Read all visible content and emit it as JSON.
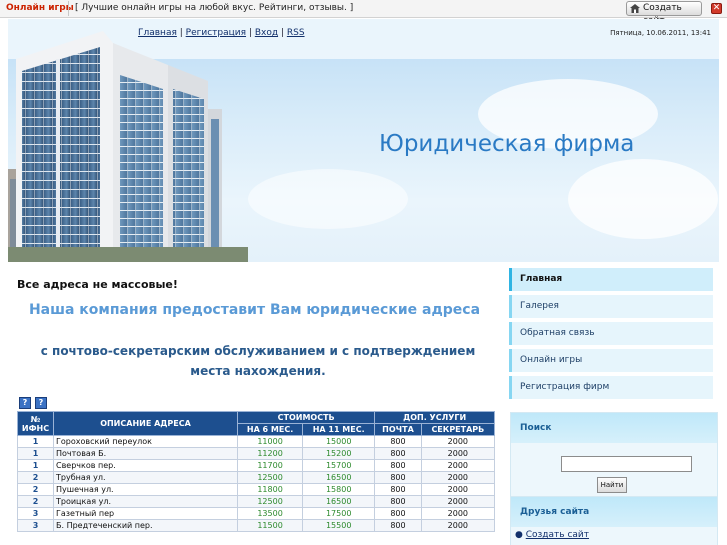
{
  "topbar": {
    "brand": "Онлайн игры",
    "tagline": "[ Лучшие онлайн игры на любой вкус. Рейтинги, отзывы. ]",
    "create_site": "Создать сайт",
    "close": "✕"
  },
  "header": {
    "nav": [
      "Главная",
      "Регистрация",
      "Вход",
      "RSS"
    ],
    "date": "Пятница, 10.06.2011, 13:41",
    "site_title": "Юридическая фирма"
  },
  "content": {
    "heading": "Все адреса не массовые!",
    "lead": "Наша компания предоставит Вам юридические адреса",
    "sub": "с почтово-секретарским обслуживанием  и  с подтверждением места нахождения.",
    "help_buttons": [
      "?",
      "?"
    ],
    "table": {
      "col_num": "№ ИФНС",
      "col_desc": "ОПИСАНИЕ АДРЕСА",
      "group_cost": "СТОИМОСТЬ",
      "group_extra": "ДОП. УСЛУГИ",
      "sub_6": "НА 6 МЕС.",
      "sub_11": "НА 11 МЕС.",
      "sub_mail": "ПОЧТА",
      "sub_secr": "СЕКРЕТАРЬ",
      "rows": [
        {
          "num": "1",
          "desc": "Гороховский переулок",
          "m6": "11000",
          "m11": "15000",
          "mail": "800",
          "secr": "2000"
        },
        {
          "num": "1",
          "desc": "Почтовая Б.",
          "m6": "11200",
          "m11": "15200",
          "mail": "800",
          "secr": "2000"
        },
        {
          "num": "1",
          "desc": "Сверчков пер.",
          "m6": "11700",
          "m11": "15700",
          "mail": "800",
          "secr": "2000"
        },
        {
          "num": "2",
          "desc": "Трубная ул.",
          "m6": "12500",
          "m11": "16500",
          "mail": "800",
          "secr": "2000"
        },
        {
          "num": "2",
          "desc": "Пушечная ул.",
          "m6": "11800",
          "m11": "15800",
          "mail": "800",
          "secr": "2000"
        },
        {
          "num": "2",
          "desc": "Троицкая ул.",
          "m6": "12500",
          "m11": "16500",
          "mail": "800",
          "secr": "2000"
        },
        {
          "num": "3",
          "desc": "Газетный пер",
          "m6": "13500",
          "m11": "17500",
          "mail": "800",
          "secr": "2000"
        },
        {
          "num": "3",
          "desc": "Б. Предтеченский пер.",
          "m6": "11500",
          "m11": "15500",
          "mail": "800",
          "secr": "2000"
        }
      ]
    }
  },
  "sidebar": {
    "menu": [
      "Главная",
      "Галерея",
      "Обратная связь",
      "Онлайн игры",
      "Регистрация фирм"
    ],
    "search_title": "Поиск",
    "search_button": "Найти",
    "friends_title": "Друзья сайта",
    "friends_link": "Создать сайт"
  },
  "colors": {
    "title_blue": "#2a7ac4",
    "table_head": "#1d4f8f",
    "menu_accent": "#2fb4e3"
  }
}
